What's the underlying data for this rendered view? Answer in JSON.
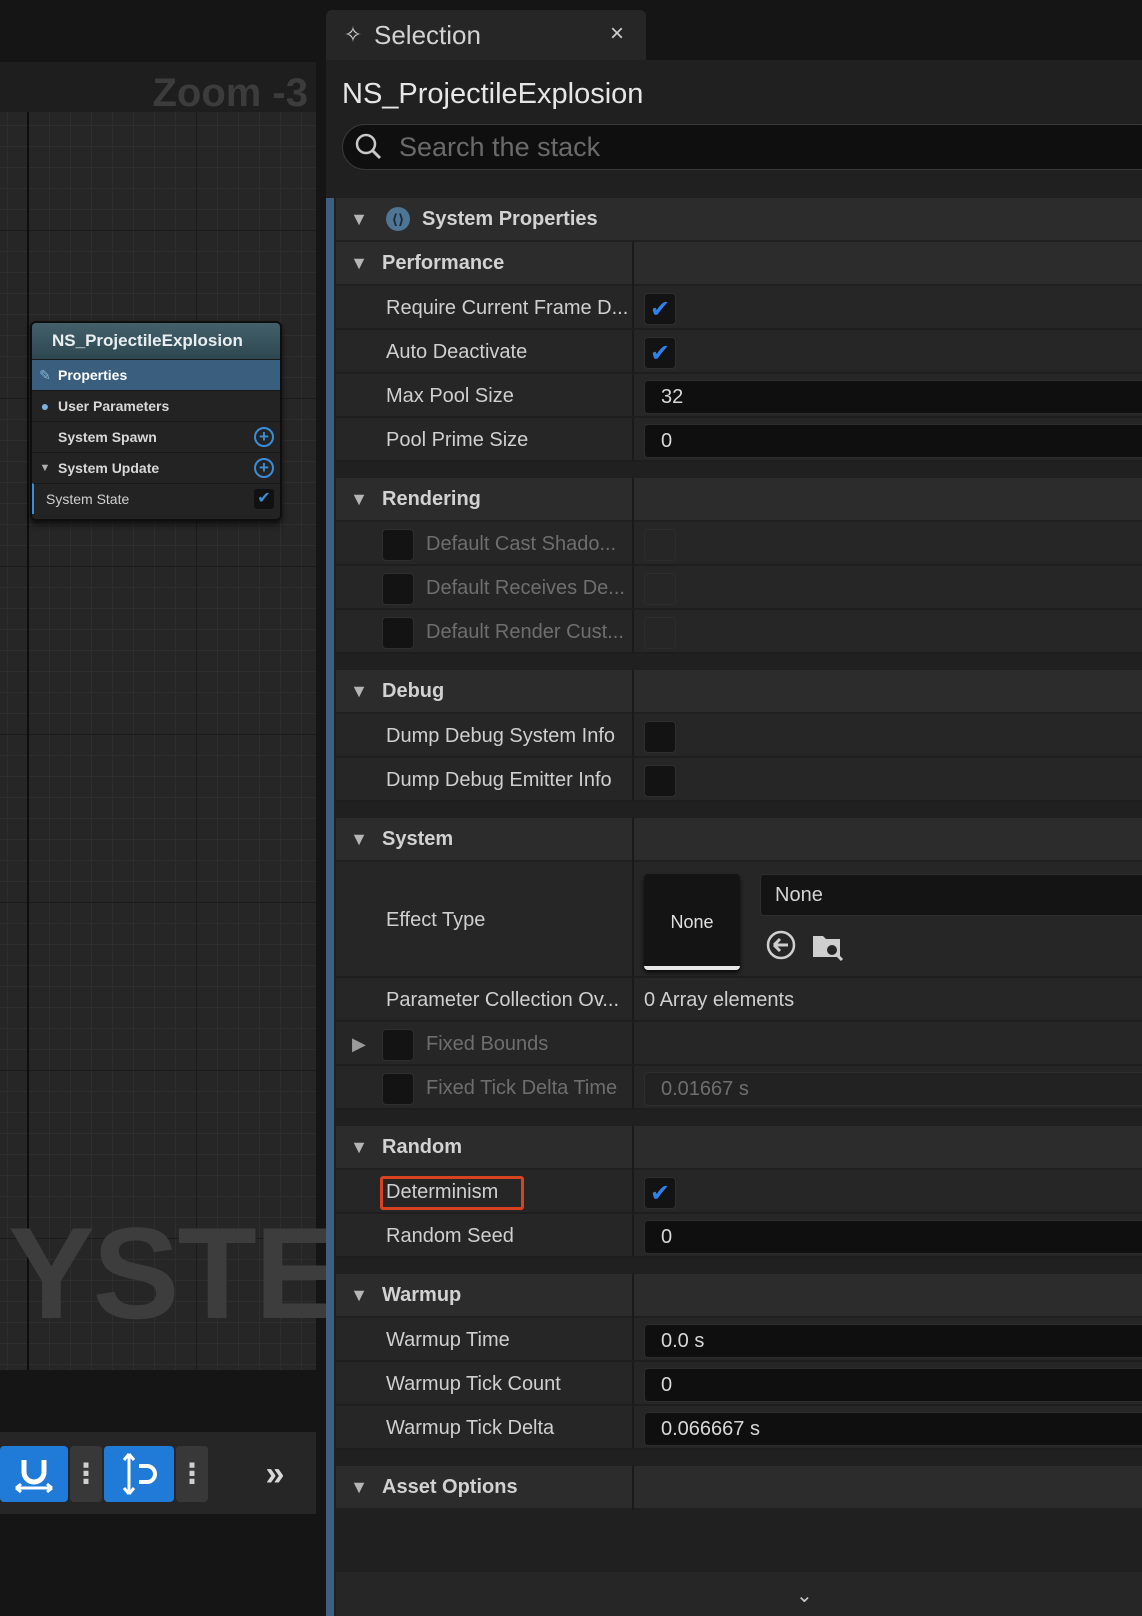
{
  "graph": {
    "zoom_label": "Zoom -3",
    "watermark": "YSTEM",
    "node": {
      "title": "NS_ProjectileExplosion",
      "rows": [
        {
          "label": "Properties"
        },
        {
          "label": "User Parameters"
        },
        {
          "label": "System Spawn"
        },
        {
          "label": "System Update"
        },
        {
          "label": "System State"
        }
      ]
    },
    "toolbar": {
      "snap_icon": "magnet-icon",
      "align_icon": "vertical-snap-icon",
      "more_icon": "double-chevron-right-icon",
      "dots": "⋮",
      "more": "»"
    }
  },
  "tab": {
    "title": "Selection",
    "close": "×"
  },
  "panel": {
    "asset_title": "NS_ProjectileExplosion",
    "search_placeholder": "Search the stack",
    "system_properties": "System Properties",
    "performance": {
      "label": "Performance",
      "require_current_frame": "Require Current Frame D...",
      "auto_deactivate": "Auto Deactivate",
      "max_pool_size": "Max Pool Size",
      "max_pool_size_value": "32",
      "pool_prime_size": "Pool Prime Size",
      "pool_prime_size_value": "0"
    },
    "rendering": {
      "label": "Rendering",
      "cast_shadow": "Default Cast Shado...",
      "receives_decals": "Default Receives De...",
      "render_custom": "Default Render Cust..."
    },
    "debug": {
      "label": "Debug",
      "dump_system": "Dump Debug System Info",
      "dump_emitter": "Dump Debug Emitter Info"
    },
    "system": {
      "label": "System",
      "effect_type": "Effect Type",
      "effect_thumb": "None",
      "effect_combo": "None",
      "param_collection": "Parameter Collection Ov...",
      "param_collection_value": "0 Array elements",
      "fixed_bounds": "Fixed Bounds",
      "fixed_tick": "Fixed Tick Delta Time",
      "fixed_tick_value": "0.01667 s"
    },
    "random": {
      "label": "Random",
      "determinism": "Determinism",
      "random_seed": "Random Seed",
      "random_seed_value": "0"
    },
    "warmup": {
      "label": "Warmup",
      "warmup_time": "Warmup Time",
      "warmup_time_value": "0.0 s",
      "warmup_tick_count": "Warmup Tick Count",
      "warmup_tick_count_value": "0",
      "warmup_tick_delta": "Warmup Tick Delta",
      "warmup_tick_delta_value": "0.066667 s"
    },
    "asset_options": {
      "label": "Asset Options"
    },
    "check_mark": "✔",
    "arrow_down": "▼",
    "arrow_right": "▶",
    "scroll_down": "⌄"
  },
  "colors": {
    "accent": "#2f80e8",
    "highlight": "#d8431f",
    "selected_row": "#3a5f7e"
  }
}
